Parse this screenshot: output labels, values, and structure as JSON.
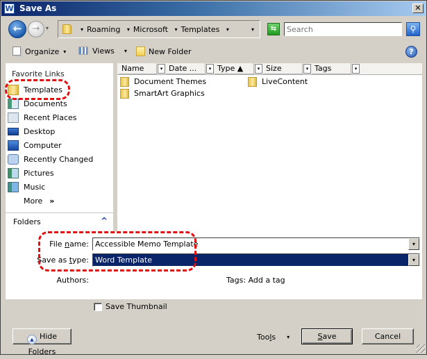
{
  "window": {
    "title": "Save As",
    "app_icon_letter": "W",
    "close_glyph": "✕"
  },
  "address_bar": {
    "back_glyph": "←",
    "forward_glyph": "→",
    "dropdown_glyph": "▾",
    "breadcrumbs": [
      "Roaming",
      "Microsoft",
      "Templates"
    ],
    "separator_glyph": "▾",
    "refresh_glyph": "⇆",
    "search_placeholder": "Search",
    "search_glyph": "⚲"
  },
  "toolbar": {
    "organize_label": "Organize",
    "views_label": "Views",
    "new_folder_label": "New Folder",
    "caret_glyph": "▾",
    "help_glyph": "?"
  },
  "nav": {
    "section_title": "Favorite Links",
    "items": [
      {
        "label": "Templates",
        "icon": "folder-icon"
      },
      {
        "label": "Documents",
        "icon": "documents-icon"
      },
      {
        "label": "Recent Places",
        "icon": "recent-places-icon"
      },
      {
        "label": "Desktop",
        "icon": "desktop-icon"
      },
      {
        "label": "Computer",
        "icon": "computer-icon"
      },
      {
        "label": "Recently Changed",
        "icon": "recently-changed-icon"
      },
      {
        "label": "Pictures",
        "icon": "pictures-icon"
      },
      {
        "label": "Music",
        "icon": "music-icon"
      }
    ],
    "more_label": "More",
    "more_glyph": "»",
    "folders_label": "Folders",
    "folders_glyph": "^"
  },
  "file_list": {
    "columns": [
      {
        "label": "Name"
      },
      {
        "label": "Date ..."
      },
      {
        "label": "Type ▲"
      },
      {
        "label": "Size"
      },
      {
        "label": "Tags"
      }
    ],
    "col_dd_glyph": "▾",
    "items": [
      {
        "name": "Document Themes",
        "type": "folder"
      },
      {
        "name": "SmartArt Graphics",
        "type": "folder"
      },
      {
        "name": "LiveContent",
        "type": "folder"
      }
    ]
  },
  "form": {
    "file_name_label_pre": "File ",
    "file_name_label_u": "n",
    "file_name_label_post": "ame:",
    "file_name_value": "Accessible Memo Template",
    "save_type_label_pre": "Save as ",
    "save_type_label_u": "t",
    "save_type_label_post": "ype:",
    "save_type_value": "Word Template",
    "authors_label": "Authors:",
    "tags_label": "Tags:",
    "tags_value": "Add a tag",
    "dd_glyph": "▾"
  },
  "footer": {
    "save_thumbnail_label": "Save Thumbnail",
    "save_thumbnail_checked": false,
    "hide_folders_label": "Hide Folders",
    "hide_glyph": "▲",
    "tools_pre": "Too",
    "tools_u": "l",
    "tools_post": "s",
    "tools_caret": "▾",
    "save_u": "S",
    "save_post": "ave",
    "cancel_label": "Cancel"
  },
  "annotation": {
    "callout_color": "#e01010"
  }
}
